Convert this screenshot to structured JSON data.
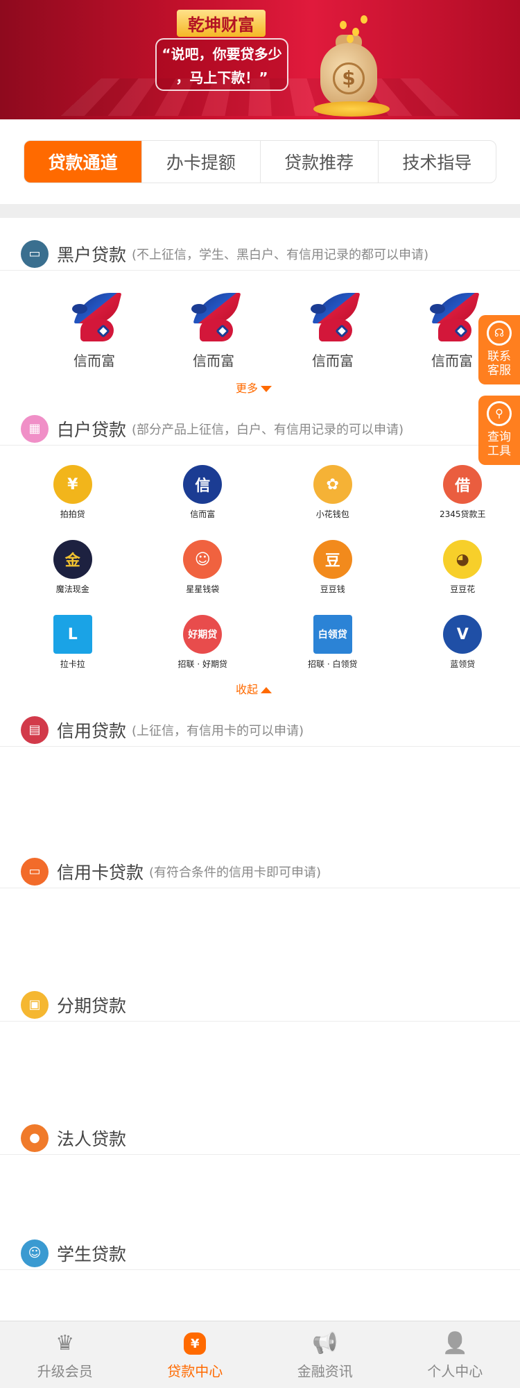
{
  "banner": {
    "brand": "乾坤财富",
    "slogan_line1": "“说吧，你要贷多少",
    "slogan_line2": "，马上下款！”",
    "bag_symbol": "$"
  },
  "tabs": [
    {
      "label": "贷款通道",
      "active": true
    },
    {
      "label": "办卡提额",
      "active": false
    },
    {
      "label": "贷款推荐",
      "active": false
    },
    {
      "label": "技术指导",
      "active": false
    }
  ],
  "sections": {
    "heihu": {
      "title": "黑户贷款",
      "note": "(不上征信，学生、黑白户、有信用记录的都可以申请)",
      "icon_color": "#3a6f8f"
    },
    "baihu": {
      "title": "白户贷款",
      "note": "(部分产品上征信，白户、有信用记录的可以申请)",
      "icon_color": "#f08fc7"
    },
    "xinyong": {
      "title": "信用贷款",
      "note": "(上征信，有信用卡的可以申请)",
      "icon_color": "#d23a4a"
    },
    "xinyongka": {
      "title": "信用卡贷款",
      "note": "(有符合条件的信用卡即可申请)",
      "icon_color": "#f26b2a"
    },
    "fenqi": {
      "title": "分期贷款",
      "note": "",
      "icon_color": "#f5b731"
    },
    "faren": {
      "title": "法人贷款",
      "note": "",
      "icon_color": "#f07a2a"
    },
    "xuesheng": {
      "title": "学生贷款",
      "note": "",
      "icon_color": "#3a9ad1"
    }
  },
  "heihu_products": [
    "信而富",
    "信而富",
    "信而富",
    "信而富"
  ],
  "more_label": "更多",
  "collapse_label": "收起",
  "baihu_products": [
    {
      "label": "拍拍贷",
      "color": "#f2b51b",
      "glyph": "¥"
    },
    {
      "label": "信而富",
      "color": "#1b3c93",
      "glyph": "信"
    },
    {
      "label": "小花钱包",
      "color": "#f5b236",
      "glyph": "✿"
    },
    {
      "label": "2345贷款王",
      "color": "#ea5d3f",
      "glyph": "借"
    },
    {
      "label": "魔法现金",
      "color": "#1d2140",
      "glyph": "金"
    },
    {
      "label": "星星钱袋",
      "color": "#f0623f",
      "glyph": "☺"
    },
    {
      "label": "豆豆钱",
      "color": "#f28a1c",
      "glyph": "豆"
    },
    {
      "label": "豆豆花",
      "color": "#f7cf2a",
      "glyph": "◕"
    },
    {
      "label": "拉卡拉",
      "color": "#1aa3e6",
      "glyph": "L"
    },
    {
      "label": "招联 · 好期贷",
      "color": "#e84c4c",
      "glyph": "好期贷"
    },
    {
      "label": "招联 · 白领贷",
      "color": "#2b83d6",
      "glyph": "白领贷"
    },
    {
      "label": "蓝领贷",
      "color": "#1f4fa6",
      "glyph": "V"
    }
  ],
  "float": {
    "service_label_1": "联系",
    "service_label_2": "客服",
    "query_label_1": "查询",
    "query_label_2": "工具"
  },
  "bottom_nav": [
    {
      "label": "升级会员",
      "icon": "crown-icon",
      "glyph": "♛",
      "active": false
    },
    {
      "label": "贷款中心",
      "icon": "money-bag-icon",
      "glyph": "¥",
      "active": true
    },
    {
      "label": "金融资讯",
      "icon": "megaphone-icon",
      "glyph": "📢",
      "active": false
    },
    {
      "label": "个人中心",
      "icon": "person-icon",
      "glyph": "👤",
      "active": false
    }
  ],
  "colors": {
    "accent": "#ff6a00",
    "banner_red": "#c2102b"
  }
}
